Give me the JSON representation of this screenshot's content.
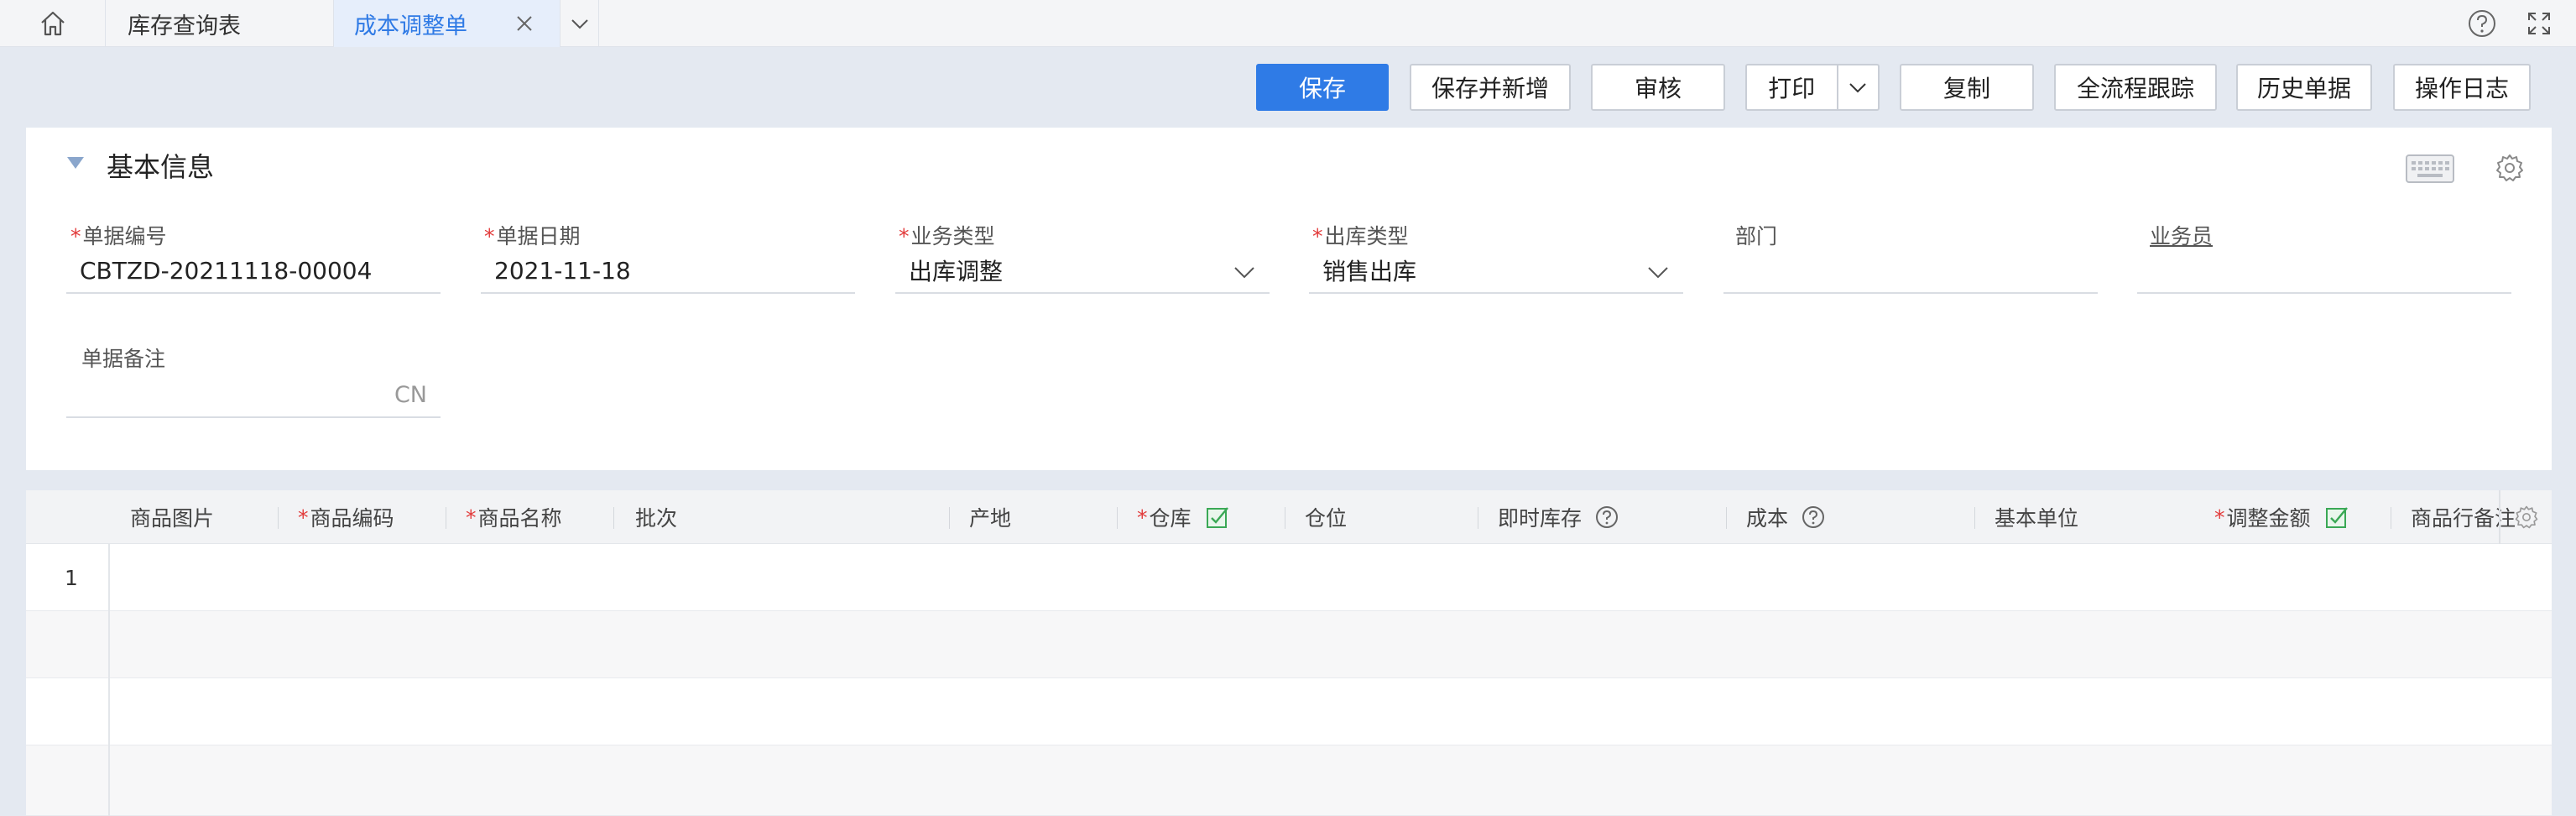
{
  "tabs": {
    "home_icon": "home-icon",
    "items": [
      {
        "label": "库存查询表"
      },
      {
        "label": "成本调整单"
      }
    ],
    "more_icon": "chevron-down-icon",
    "help_icon": "help-circle-icon",
    "fullscreen_icon": "fullscreen-icon"
  },
  "toolbar": {
    "save": "保存",
    "save_new": "保存并新增",
    "audit": "审核",
    "print": "打印",
    "copy": "复制",
    "trace": "全流程跟踪",
    "history": "历史单据",
    "log": "操作日志"
  },
  "basic_info": {
    "title": "基本信息",
    "fields": {
      "doc_no": {
        "label": "单据编号",
        "value": "CBTZD-20211118-00004"
      },
      "doc_date": {
        "label": "单据日期",
        "value": "2021-11-18"
      },
      "biz_type": {
        "label": "业务类型",
        "value": "出库调整"
      },
      "out_type": {
        "label": "出库类型",
        "value": "销售出库"
      },
      "dept": {
        "label": "部门",
        "value": ""
      },
      "salesman": {
        "label": "业务员",
        "value": ""
      },
      "remark": {
        "label": "单据备注",
        "value": "",
        "hint": "CN"
      }
    }
  },
  "grid": {
    "columns": [
      {
        "label": "商品图片"
      },
      {
        "label": "商品编码"
      },
      {
        "label": "商品名称"
      },
      {
        "label": "批次"
      },
      {
        "label": "产地"
      },
      {
        "label": "仓库"
      },
      {
        "label": "仓位"
      },
      {
        "label": "即时库存"
      },
      {
        "label": "成本"
      },
      {
        "label": "基本单位"
      },
      {
        "label": "调整金额"
      },
      {
        "label": "商品行备注"
      }
    ],
    "rows": [
      {
        "index": "1"
      }
    ]
  },
  "colors": {
    "primary": "#2f7be6",
    "required": "#e23b3b",
    "background": "#e4e9f1"
  }
}
